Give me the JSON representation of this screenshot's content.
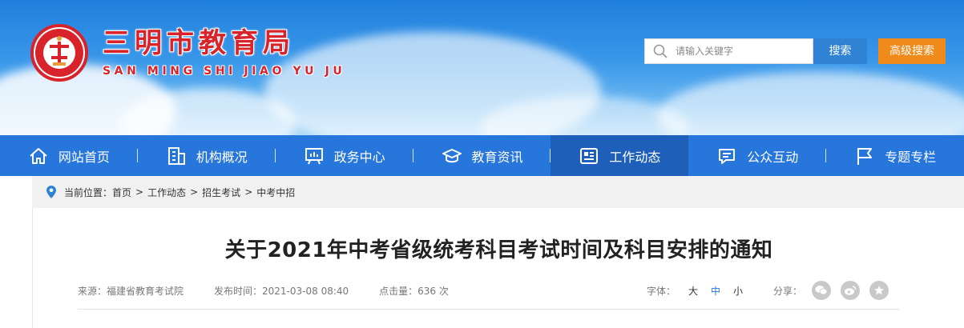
{
  "header": {
    "site_name_cn": "三明市教育局",
    "site_name_en": "SAN MING SHI JIAO YU JU",
    "search": {
      "placeholder": "请输入关键字",
      "button_label": "搜索",
      "advanced_label": "高级搜索"
    }
  },
  "nav": {
    "items": [
      {
        "label": "网站首页",
        "icon": "home-icon"
      },
      {
        "label": "机构概况",
        "icon": "building-icon"
      },
      {
        "label": "政务中心",
        "icon": "presentation-icon"
      },
      {
        "label": "教育资讯",
        "icon": "graduation-cap-icon"
      },
      {
        "label": "工作动态",
        "icon": "news-icon",
        "active": true
      },
      {
        "label": "公众互动",
        "icon": "chat-icon"
      },
      {
        "label": "专题专栏",
        "icon": "flag-icon"
      }
    ]
  },
  "breadcrumb": {
    "prefix": "当前位置：",
    "items": [
      "首页",
      "工作动态",
      "招生考试",
      "中考中招"
    ],
    "separator": ">"
  },
  "article": {
    "title": "关于2021年中考省级统考科目考试时间及科目安排的通知",
    "source": "来源：福建省教育考试院",
    "publish_time": "发布时间：2021-03-08 08:40",
    "views": "点击量：636 次",
    "font_size_label": "字体：",
    "font_sizes": [
      "大",
      "中",
      "小"
    ],
    "font_size_active": "中",
    "share_label": "分享："
  },
  "colors": {
    "nav_bg": "#2776dc",
    "nav_active": "#1e5fba",
    "brand_red": "#d8232a",
    "search_btn": "#2f82d4",
    "advanced_btn": "#f08a1a"
  }
}
